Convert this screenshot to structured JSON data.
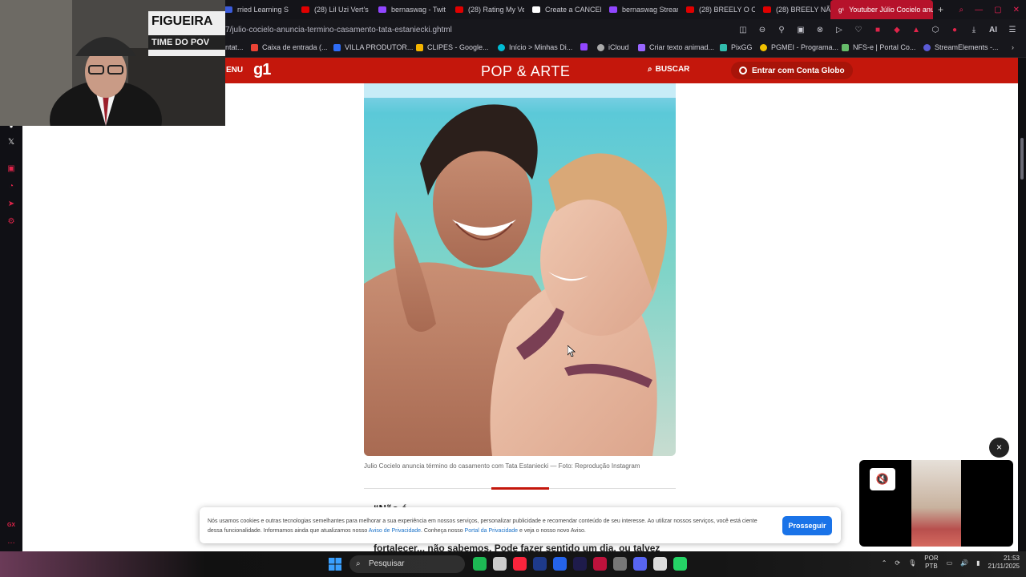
{
  "tabs": [
    {
      "label": "rried Learning S",
      "color": "#3b5bdb"
    },
    {
      "label": "(28) Lil Uzi Vert's",
      "color": "#e00000"
    },
    {
      "label": "bernaswag - Twit",
      "color": "#9146ff"
    },
    {
      "label": "(28) Rating My Ve",
      "color": "#e00000"
    },
    {
      "label": "Create a CANCEL",
      "color": "#ffffff"
    },
    {
      "label": "bernaswag Strean",
      "color": "#9146ff"
    },
    {
      "label": "(28) BREELY O CA",
      "color": "#e00000"
    },
    {
      "label": "(28) BREELY NÃO",
      "color": "#e00000"
    }
  ],
  "active_tab": {
    "label": "Youtuber Júlio Cocielo anu",
    "icon": "g1-icon"
  },
  "new_tab": "+",
  "url": "7/julio-cocielo-anuncia-termino-casamento-tata-estaniecki.ghtml",
  "bookmarks": [
    {
      "label": "ntat...",
      "color": "#888888"
    },
    {
      "label": "Caixa de entrada (...",
      "color": "#ea4335"
    },
    {
      "label": "VILLA PRODUTOR...",
      "color": "#2f6df6"
    },
    {
      "label": "CLIPES - Google...",
      "color": "#f4b400"
    },
    {
      "label": "Início > Minhas Di...",
      "color": "#00bcd4"
    },
    {
      "label": "",
      "color": "#9146ff"
    },
    {
      "label": "iCloud",
      "color": "#aaaaaa"
    },
    {
      "label": "Criar texto animad...",
      "color": "#9966ff"
    },
    {
      "label": "PixGG",
      "color": "#32bcad"
    },
    {
      "label": "PGMEI - Programa...",
      "color": "#f0c000"
    },
    {
      "label": "NFS-e | Portal Co...",
      "color": "#66bb6a"
    },
    {
      "label": "StreamElements -...",
      "color": "#5b5bd6"
    }
  ],
  "g1": {
    "menu": "ENU",
    "logo": "g1",
    "section": "POP & ARTE",
    "search": "BUSCAR",
    "login": "Entrar com Conta Globo"
  },
  "article": {
    "caption": "Julio Cocielo anuncia término do casamento com Tata Estaniecki — Foto: Reprodução Instagram",
    "quote_line_1": "“Não é ...",
    "quote_line_2": "fortalecer... não sabemos. Pode fazer sentido um dia, ou talvez"
  },
  "cookie": {
    "text_1": "Nós usamos cookies e outras tecnologias semelhantes para melhorar a sua experiência em nossos serviços, personalizar publicidade e recomendar conteúdo de seu interesse. Ao utilizar nossos serviços, você está ciente dessa funcionalidade. Informamos ainda que atualizamos nosso ",
    "link_1": "Aviso de Privacidade",
    "text_2": ". Conheça nosso ",
    "link_2": "Portal da Privacidade",
    "text_3": " e veja o nosso novo Aviso.",
    "button": "Prosseguir"
  },
  "player": {
    "close": "×",
    "mute": "🔇"
  },
  "webcam": {
    "banner_top": "FIGUEIRA",
    "banner_bottom": "TIME DO POV"
  },
  "taskbar": {
    "search_placeholder": "Pesquisar",
    "lang_1": "POR",
    "lang_2": "PTB",
    "time": "21:53",
    "date": "21/11/2025",
    "apps": [
      "#1db954",
      "#cccccc",
      "#fa243c",
      "#1e3a8a",
      "#2563eb",
      "#1e1b4b",
      "#be123c",
      "#777777",
      "#5865f2",
      "#dddddd",
      "#25d366"
    ]
  }
}
